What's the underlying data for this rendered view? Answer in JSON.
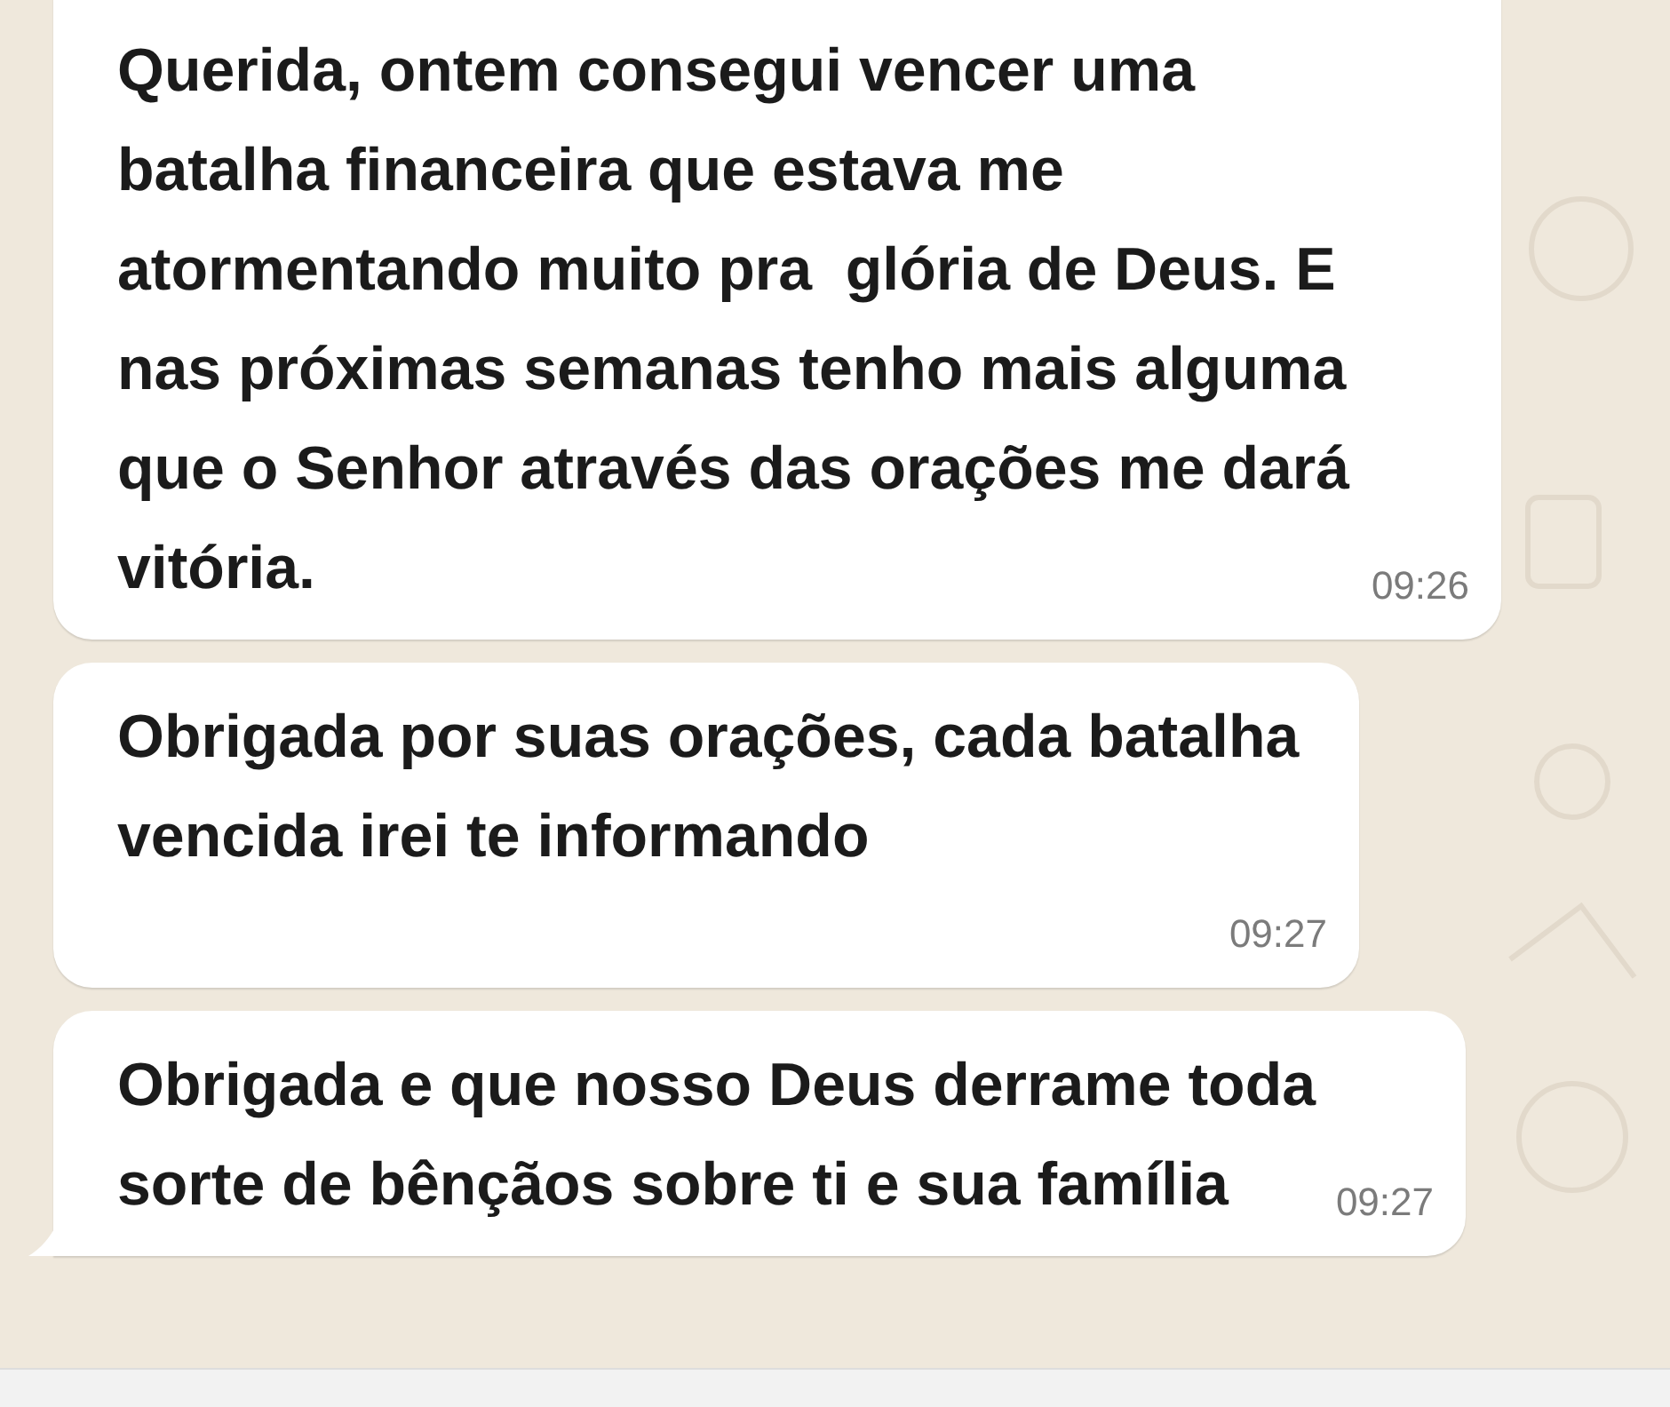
{
  "messages": [
    {
      "text": "Querida, ontem consegui vencer uma batalha financeira que estava me atormentando muito pra  glória de Deus. E nas próximas semanas tenho mais alguma que o Senhor através das orações me dará vitória.",
      "time": "09:26",
      "tail": false
    },
    {
      "text": "Obrigada por suas orações, cada batalha vencida irei te informando",
      "time": "09:27",
      "tail": false
    },
    {
      "text": "Obrigada e que nosso Deus derrame toda sorte de bênçãos sobre ti e sua família",
      "time": "09:27",
      "tail": true
    }
  ]
}
